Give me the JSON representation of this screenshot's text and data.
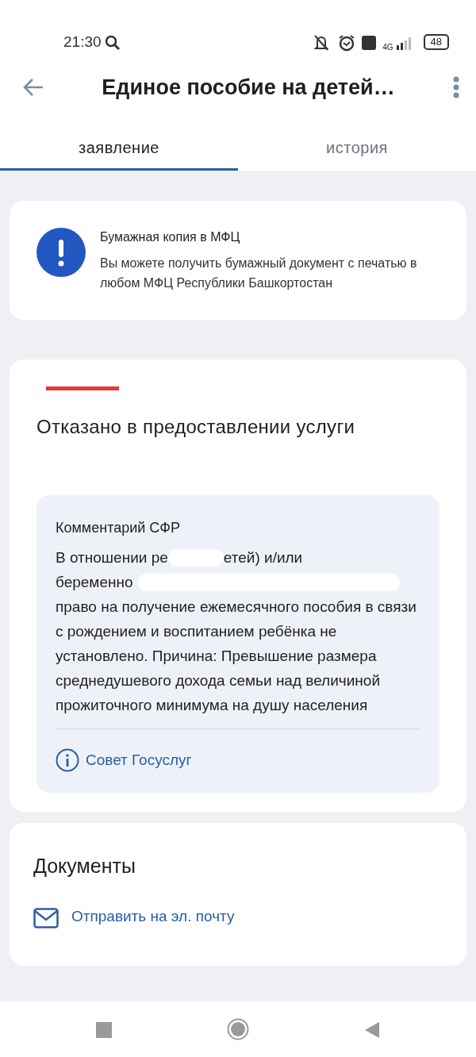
{
  "status_bar": {
    "time": "21:30",
    "battery": "48",
    "network": "4G"
  },
  "app_bar": {
    "title": "Единое пособие на детей…"
  },
  "tabs": [
    {
      "label": "заявление",
      "selected": true
    },
    {
      "label": "история",
      "selected": false
    }
  ],
  "notice": {
    "title": "Бумажная копия в МФЦ",
    "text": "Вы можете получить бумажный документ с печатью в любом МФЦ Республики Башкортостан"
  },
  "status_card": {
    "title": "Отказано в предоставлении услуги",
    "comment": {
      "title": "Комментарий СФР",
      "fragments": [
        "В отношении ре",
        "етей) и/или",
        "беременно"
      ],
      "text": "право на получение ежемесячного пособия в связи с рождением и воспитанием ребёнка не установлено. Причина: Превышение размера среднедушевого дохода семьи над величиной прожиточного минимума на душу населения",
      "advice_link": "Совет Госуслуг"
    }
  },
  "documents": {
    "title": "Документы",
    "actions": [
      {
        "label": "Отправить на эл. почту"
      }
    ]
  }
}
